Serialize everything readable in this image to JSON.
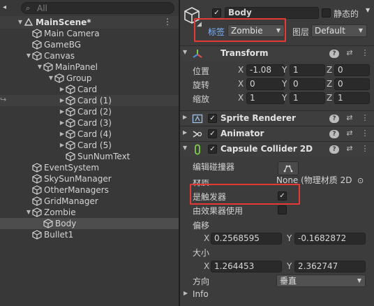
{
  "hierarchy": {
    "search_placeholder": "All",
    "scene_name": "MainScene*",
    "items": [
      {
        "label": "Main Camera"
      },
      {
        "label": "GameBG"
      },
      {
        "label": "Canvas"
      },
      {
        "label": "MainPanel"
      },
      {
        "label": "Group"
      },
      {
        "label": "Card"
      },
      {
        "label": "Card (1)"
      },
      {
        "label": "Card (2)"
      },
      {
        "label": "Card (3)"
      },
      {
        "label": "Card (4)"
      },
      {
        "label": "Card (5)"
      },
      {
        "label": "SunNumText"
      },
      {
        "label": "EventSystem"
      },
      {
        "label": "SkySunManager"
      },
      {
        "label": "OtherManagers"
      },
      {
        "label": "GridManager"
      },
      {
        "label": "Zombie"
      },
      {
        "label": "Body"
      },
      {
        "label": "Bullet1"
      }
    ]
  },
  "inspector": {
    "object_name": "Body",
    "static_label": "静态的",
    "tag_label": "标签",
    "tag_value": "Zombie",
    "layer_label": "图层",
    "layer_value": "Default",
    "transform": {
      "title": "Transform",
      "position_label": "位置",
      "rotation_label": "旋转",
      "scale_label": "缩放",
      "axis_x": "X",
      "axis_y": "Y",
      "axis_z": "Z",
      "position": {
        "x": "-1.08",
        "y": "1",
        "z": "0"
      },
      "rotation": {
        "x": "0",
        "y": "0",
        "z": "0"
      },
      "scale": {
        "x": "1",
        "y": "1",
        "z": "1"
      }
    },
    "sprite_renderer": {
      "title": "Sprite Renderer"
    },
    "animator": {
      "title": "Animator"
    },
    "capsule_collider": {
      "title": "Capsule Collider 2D",
      "edit_collider_label": "编辑碰撞器",
      "material_label": "材质",
      "material_value": "None (物理材质 2D",
      "is_trigger_label": "是触发器",
      "used_by_effector_label": "由效果器使用",
      "offset_label": "偏移",
      "offset_x": "0.2568595",
      "offset_y": "-0.1682872",
      "size_label": "大小",
      "size_x": "1.264453",
      "size_y": "2.362747",
      "direction_label": "方向",
      "direction_value": "垂直",
      "info_label": "Info"
    }
  },
  "colors": {
    "highlight_box": "#e53935",
    "tag_label_color": "#7cb6ff"
  }
}
